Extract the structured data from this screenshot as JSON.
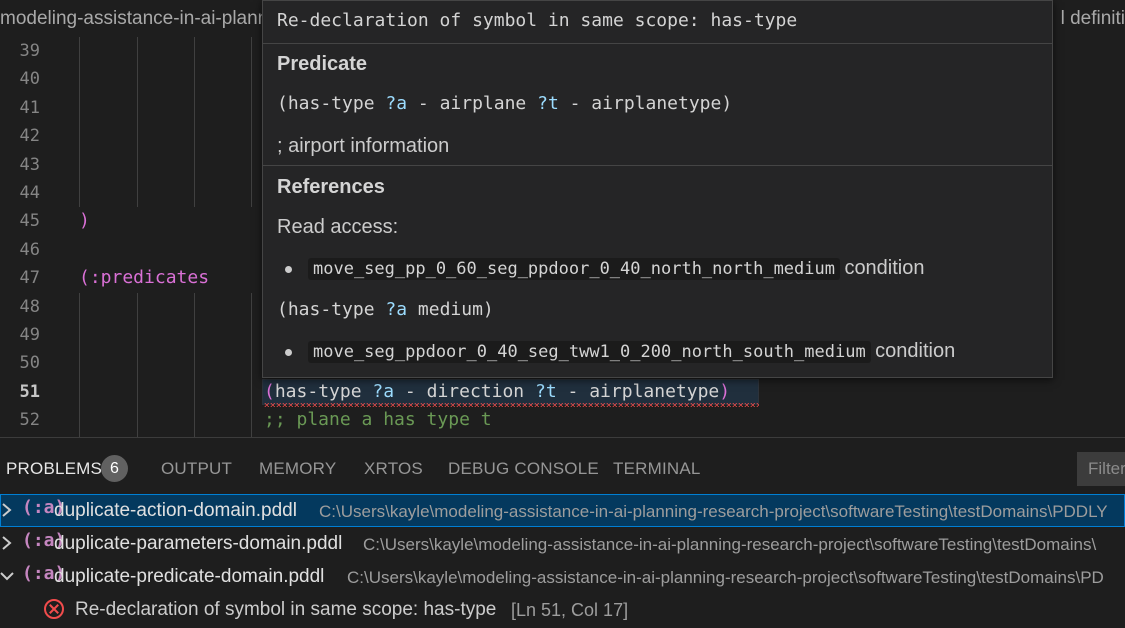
{
  "breadcrumb": {
    "left": "modeling-assistance-in-ai-planni",
    "right": "l definiti"
  },
  "editor": {
    "lines": [
      {
        "num": "39",
        "code": ""
      },
      {
        "num": "40",
        "code": ""
      },
      {
        "num": "41",
        "code": ""
      },
      {
        "num": "42",
        "code": ""
      },
      {
        "num": "43",
        "code": ""
      },
      {
        "num": "44",
        "code": ""
      },
      {
        "num": "45",
        "code": ")"
      },
      {
        "num": "46",
        "code": ""
      },
      {
        "num": "47",
        "code": "(:predicates"
      },
      {
        "num": "48",
        "code": ""
      },
      {
        "num": "49",
        "code": ""
      },
      {
        "num": "50",
        "code": ""
      },
      {
        "num": "51",
        "code": ""
      },
      {
        "num": "52",
        "code": ""
      }
    ],
    "line51": {
      "open": "(",
      "kw": "has-type",
      "v1": "?a",
      "dash1": "-",
      "t1": "direction",
      "v2": "?t",
      "dash2": "-",
      "t2": "airplanetype",
      "close": ")"
    },
    "line52_comment": ";; plane a has type t"
  },
  "hover": {
    "title": "Re-declaration of symbol in same scope: has-type",
    "predicate_heading": "Predicate",
    "predicate_sig": {
      "open": "(has-type ",
      "v1": "?a",
      "mid": " - airplane ",
      "v2": "?t",
      "end": " - airplanetype)"
    },
    "doc_comment": "; airport information",
    "references_heading": "References",
    "read_access": "Read access:",
    "ref1_action": "move_seg_pp_0_60_seg_ppdoor_0_40_north_north_medium",
    "ref1_kind": "condition",
    "ref_usage": {
      "open": "(has-type ",
      "v1": "?a",
      "end": " medium)"
    },
    "ref2_action": "move_seg_ppdoor_0_40_seg_tww1_0_200_north_south_medium",
    "ref2_kind": "condition"
  },
  "panel": {
    "tabs": [
      "PROBLEMS",
      "OUTPUT",
      "MEMORY",
      "XRTOS",
      "DEBUG CONSOLE",
      "TERMINAL"
    ],
    "problems_count": "6",
    "filter_placeholder": "Filter",
    "problems": [
      {
        "icon": "(:a)",
        "file": "duplicate-action-domain.pddl",
        "path": "C:\\Users\\kayle\\modeling-assistance-in-ai-planning-research-project\\softwareTesting\\testDomains\\PDDLY",
        "expanded": false
      },
      {
        "icon": "(:a)",
        "file": "duplicate-parameters-domain.pddl",
        "path": "C:\\Users\\kayle\\modeling-assistance-in-ai-planning-research-project\\softwareTesting\\testDomains\\",
        "expanded": false
      },
      {
        "icon": "(:a)",
        "file": "duplicate-predicate-domain.pddl",
        "path": "C:\\Users\\kayle\\modeling-assistance-in-ai-planning-research-project\\softwareTesting\\testDomains\\PD",
        "expanded": true
      }
    ],
    "error": {
      "message": "Re-declaration of symbol in same scope: has-type",
      "location": "[Ln 51, Col 17]"
    }
  },
  "colors": {
    "editor_bg": "#1e1e1e",
    "hover_bg": "#252526",
    "keyword_purple": "#da70d6",
    "variable_blue": "#9cdcfe",
    "comment_green": "#6a9955",
    "error_red": "#f14c4c",
    "selection_blue": "#04395e"
  }
}
